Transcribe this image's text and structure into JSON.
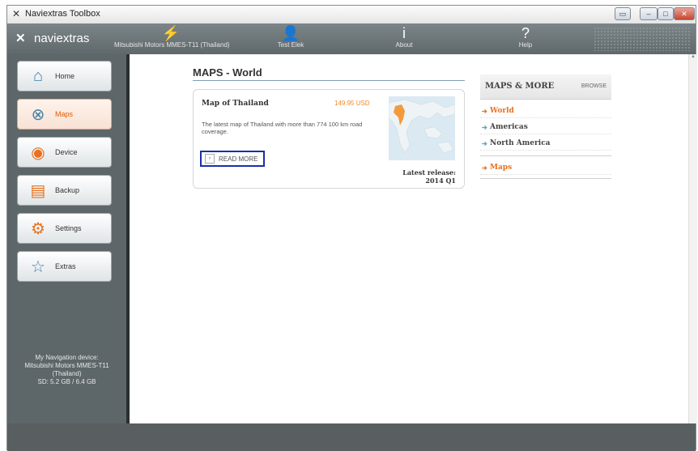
{
  "window": {
    "icon": "naviextras-x-icon",
    "title": "Naviextras Toolbox",
    "buttons": [
      "restore",
      "minimize",
      "maximize",
      "close"
    ]
  },
  "header": {
    "logo": "naviextras",
    "items": [
      {
        "label": "Mitsubishi Motors MMES-T11 (Thailand)",
        "icon": "plug-icon"
      },
      {
        "label": "Test Elek",
        "icon": "user-icon"
      },
      {
        "label": "About",
        "icon": "info-icon"
      },
      {
        "label": "Help",
        "icon": "question-icon"
      }
    ]
  },
  "sidebar": {
    "items": [
      {
        "label": "Home",
        "icon": "house-icon",
        "active": false
      },
      {
        "label": "Maps",
        "icon": "compass-icon",
        "active": true
      },
      {
        "label": "Device",
        "icon": "device-icon",
        "active": false
      },
      {
        "label": "Backup",
        "icon": "backup-icon",
        "active": false
      },
      {
        "label": "Settings",
        "icon": "gear-icon",
        "active": false
      },
      {
        "label": "Extras",
        "icon": "star-icon",
        "active": false
      }
    ],
    "device_info": {
      "line1": "My Navigation device:",
      "line2": "Mitsubishi Motors MMES-T11",
      "line3": "(Thailand)",
      "line4": "SD: 5.2 GB / 6.4 GB"
    }
  },
  "main": {
    "title": "MAPS - World",
    "product": {
      "name": "Map of Thailand",
      "price": "149.95 USD",
      "description": "The latest map of Thailand with more than 774 100 km road coverage.",
      "read_more": "READ MORE",
      "release_label": "Latest release:",
      "release_value": "2014 Q1"
    }
  },
  "panel": {
    "title": "MAPS & MORE",
    "browse": "BROWSE",
    "rows": [
      {
        "label": "World",
        "style": "orange"
      },
      {
        "label": "Americas",
        "style": "blue"
      },
      {
        "label": "North America",
        "style": "blue"
      },
      {
        "label": "Maps",
        "style": "orange"
      }
    ]
  },
  "colors": {
    "accent": "#e8701e",
    "sidebar": "#5d6669",
    "highlight_border": "#1a2fa8"
  }
}
